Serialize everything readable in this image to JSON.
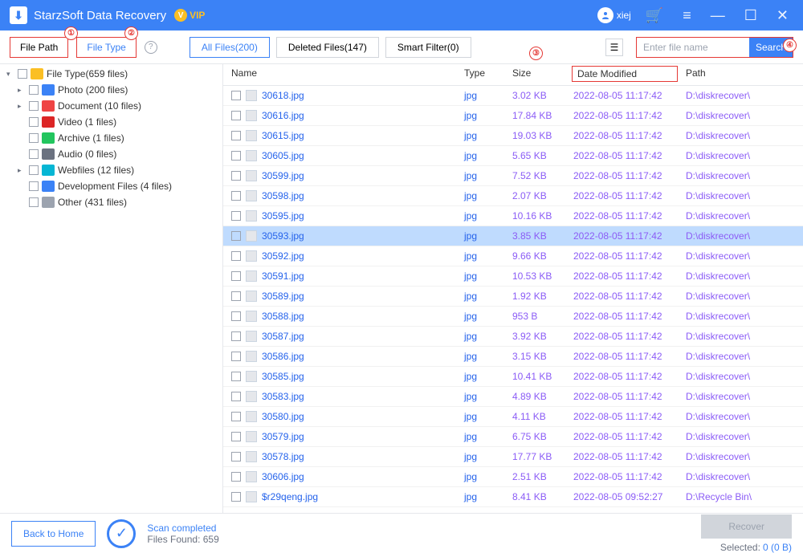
{
  "title": "StarzSoft Data Recovery",
  "vip": "VIP",
  "user": "xiej",
  "toolbar": {
    "file_path": "File Path",
    "file_type": "File Type",
    "all_files": "All Files(200)",
    "deleted_files": "Deleted Files(147)",
    "smart_filter": "Smart Filter(0)",
    "search_placeholder": "Enter file name",
    "search_btn": "Search"
  },
  "annot": {
    "a1": "①",
    "a2": "②",
    "a3": "③",
    "a4": "④"
  },
  "tree": {
    "root": "File Type(659 files)",
    "items": [
      {
        "label": "Photo  (200 files)",
        "color": "#3b82f6",
        "chev": true
      },
      {
        "label": "Document  (10 files)",
        "color": "#ef4444",
        "chev": true
      },
      {
        "label": "Video  (1 files)",
        "color": "#dc2626",
        "chev": false
      },
      {
        "label": "Archive  (1 files)",
        "color": "#22c55e",
        "chev": false
      },
      {
        "label": "Audio  (0 files)",
        "color": "#6b7280",
        "chev": false
      },
      {
        "label": "Webfiles  (12 files)",
        "color": "#06b6d4",
        "chev": true
      },
      {
        "label": "Development Files  (4 files)",
        "color": "#3b82f6",
        "chev": false
      },
      {
        "label": "Other  (431 files)",
        "color": "#9ca3af",
        "chev": false
      }
    ]
  },
  "columns": {
    "name": "Name",
    "type": "Type",
    "size": "Size",
    "date": "Date Modified",
    "path": "Path"
  },
  "rows": [
    {
      "n": "30618.jpg",
      "t": "jpg",
      "s": "3.02 KB",
      "d": "2022-08-05 11:17:42",
      "p": "D:\\diskrecover\\"
    },
    {
      "n": "30616.jpg",
      "t": "jpg",
      "s": "17.84 KB",
      "d": "2022-08-05 11:17:42",
      "p": "D:\\diskrecover\\"
    },
    {
      "n": "30615.jpg",
      "t": "jpg",
      "s": "19.03 KB",
      "d": "2022-08-05 11:17:42",
      "p": "D:\\diskrecover\\"
    },
    {
      "n": "30605.jpg",
      "t": "jpg",
      "s": "5.65 KB",
      "d": "2022-08-05 11:17:42",
      "p": "D:\\diskrecover\\"
    },
    {
      "n": "30599.jpg",
      "t": "jpg",
      "s": "7.52 KB",
      "d": "2022-08-05 11:17:42",
      "p": "D:\\diskrecover\\"
    },
    {
      "n": "30598.jpg",
      "t": "jpg",
      "s": "2.07 KB",
      "d": "2022-08-05 11:17:42",
      "p": "D:\\diskrecover\\"
    },
    {
      "n": "30595.jpg",
      "t": "jpg",
      "s": "10.16 KB",
      "d": "2022-08-05 11:17:42",
      "p": "D:\\diskrecover\\"
    },
    {
      "n": "30593.jpg",
      "t": "jpg",
      "s": "3.85 KB",
      "d": "2022-08-05 11:17:42",
      "p": "D:\\diskrecover\\",
      "sel": true
    },
    {
      "n": "30592.jpg",
      "t": "jpg",
      "s": "9.66 KB",
      "d": "2022-08-05 11:17:42",
      "p": "D:\\diskrecover\\"
    },
    {
      "n": "30591.jpg",
      "t": "jpg",
      "s": "10.53 KB",
      "d": "2022-08-05 11:17:42",
      "p": "D:\\diskrecover\\"
    },
    {
      "n": "30589.jpg",
      "t": "jpg",
      "s": "1.92 KB",
      "d": "2022-08-05 11:17:42",
      "p": "D:\\diskrecover\\"
    },
    {
      "n": "30588.jpg",
      "t": "jpg",
      "s": "953 B",
      "d": "2022-08-05 11:17:42",
      "p": "D:\\diskrecover\\"
    },
    {
      "n": "30587.jpg",
      "t": "jpg",
      "s": "3.92 KB",
      "d": "2022-08-05 11:17:42",
      "p": "D:\\diskrecover\\"
    },
    {
      "n": "30586.jpg",
      "t": "jpg",
      "s": "3.15 KB",
      "d": "2022-08-05 11:17:42",
      "p": "D:\\diskrecover\\"
    },
    {
      "n": "30585.jpg",
      "t": "jpg",
      "s": "10.41 KB",
      "d": "2022-08-05 11:17:42",
      "p": "D:\\diskrecover\\"
    },
    {
      "n": "30583.jpg",
      "t": "jpg",
      "s": "4.89 KB",
      "d": "2022-08-05 11:17:42",
      "p": "D:\\diskrecover\\"
    },
    {
      "n": "30580.jpg",
      "t": "jpg",
      "s": "4.11 KB",
      "d": "2022-08-05 11:17:42",
      "p": "D:\\diskrecover\\"
    },
    {
      "n": "30579.jpg",
      "t": "jpg",
      "s": "6.75 KB",
      "d": "2022-08-05 11:17:42",
      "p": "D:\\diskrecover\\"
    },
    {
      "n": "30578.jpg",
      "t": "jpg",
      "s": "17.77 KB",
      "d": "2022-08-05 11:17:42",
      "p": "D:\\diskrecover\\"
    },
    {
      "n": "30606.jpg",
      "t": "jpg",
      "s": "2.51 KB",
      "d": "2022-08-05 11:17:42",
      "p": "D:\\diskrecover\\"
    },
    {
      "n": "$r29qeng.jpg",
      "t": "jpg",
      "s": "8.41 KB",
      "d": "2022-08-05 09:52:27",
      "p": "D:\\Recycle Bin\\"
    }
  ],
  "footer": {
    "back": "Back to Home",
    "scan_status": "Scan completed",
    "files_found": "Files Found: 659",
    "recover": "Recover",
    "selected_label": "Selected:",
    "selected_value": "0 (0 B)"
  }
}
